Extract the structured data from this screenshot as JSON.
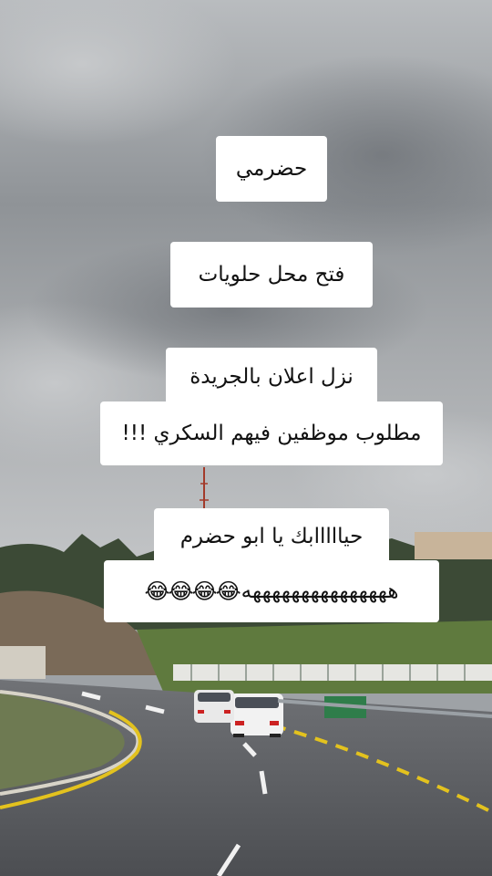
{
  "captions": {
    "line1": "حضرمي",
    "line2": "فتح محل حلويات",
    "line3a": "نزل اعلان بالجريدة",
    "line3b": "مطلوب موظفين فيهم السكري !!!",
    "line4a": "حيااااابك يا ابو حضرم",
    "line4b_text": "هههههههههههههههه",
    "line4b_emoji": "😂😂😂😂"
  },
  "colors": {
    "sky": "#9ea2a6",
    "road": "#5c5e62",
    "road_line_yellow": "#e3c21e",
    "caption_bg": "#ffffff",
    "caption_text": "#111111"
  }
}
